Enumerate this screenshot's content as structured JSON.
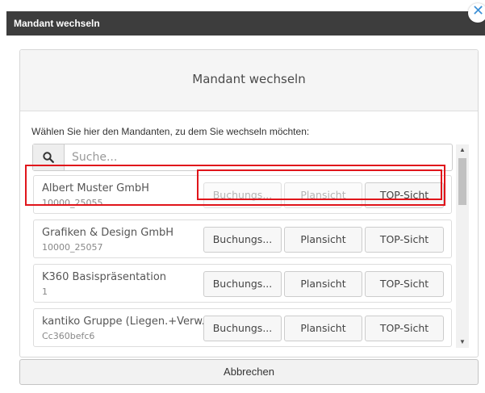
{
  "dialog": {
    "title": "Mandant wechseln",
    "close_icon": "close-icon",
    "panel_heading": "Mandant wechseln",
    "instruction": "Wählen Sie hier den Mandanten, zu dem Sie wechseln möchten:",
    "search": {
      "placeholder": "Suche...",
      "value": "",
      "icon": "search-icon"
    },
    "action_labels": {
      "booking": "Buchungs...",
      "plan": "Plansicht",
      "top": "TOP-Sicht"
    },
    "clients": [
      {
        "name": "Albert Muster GmbH",
        "id": "10000_25055",
        "highlighted": true
      },
      {
        "name": "Grafiken & Design GmbH",
        "id": "10000_25057",
        "highlighted": false
      },
      {
        "name": "K360 Basispräsentation",
        "id": "1",
        "highlighted": false
      },
      {
        "name": "kantiko Gruppe (Liegen.+Verw.)",
        "id": "Cc360befc6",
        "highlighted": false
      }
    ],
    "cancel_label": "Abbrechen"
  },
  "colors": {
    "titlebar": "#3d3d3d",
    "highlight": "#e0151b",
    "close_accent": "#3a8fd6"
  }
}
